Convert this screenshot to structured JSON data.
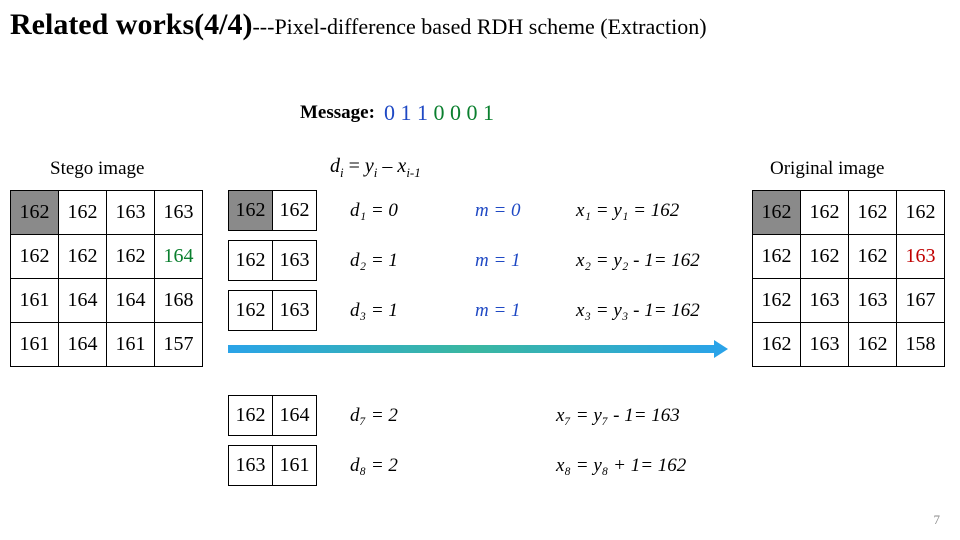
{
  "title_main": "Related works(4/4)",
  "title_sub": "---Pixel-difference based RDH scheme (Extraction)",
  "message_label": "Message:",
  "message_bits": [
    "0",
    "1",
    "1",
    "0",
    "0",
    "0",
    "1"
  ],
  "bit_colors": [
    "blue",
    "blue",
    "blue",
    "green",
    "green",
    "green",
    "green"
  ],
  "formula_d": {
    "lhs": "d",
    "sub": "i",
    "eq": " = ",
    "y": "y",
    "ysub": "i",
    "minus": " – ",
    "x": "x",
    "xsub": "i-1"
  },
  "labels": {
    "stego": "Stego image",
    "orig": "Original image"
  },
  "stego": [
    [
      {
        "v": "162",
        "c": "shade"
      },
      {
        "v": "162"
      },
      {
        "v": "163"
      },
      {
        "v": "163"
      }
    ],
    [
      {
        "v": "162"
      },
      {
        "v": "162"
      },
      {
        "v": "162"
      },
      {
        "v": "164",
        "c": "green"
      }
    ],
    [
      {
        "v": "161"
      },
      {
        "v": "164"
      },
      {
        "v": "164"
      },
      {
        "v": "168"
      }
    ],
    [
      {
        "v": "161"
      },
      {
        "v": "164"
      },
      {
        "v": "161"
      },
      {
        "v": "157"
      }
    ]
  ],
  "orig": [
    [
      {
        "v": "162",
        "c": "shade"
      },
      {
        "v": "162"
      },
      {
        "v": "162"
      },
      {
        "v": "162"
      }
    ],
    [
      {
        "v": "162"
      },
      {
        "v": "162"
      },
      {
        "v": "162"
      },
      {
        "v": "163",
        "c": "red"
      }
    ],
    [
      {
        "v": "162"
      },
      {
        "v": "163"
      },
      {
        "v": "163"
      },
      {
        "v": "167"
      }
    ],
    [
      {
        "v": "162"
      },
      {
        "v": "163"
      },
      {
        "v": "162"
      },
      {
        "v": "158"
      }
    ]
  ],
  "pairs": [
    {
      "a": "162",
      "ac": "shade",
      "b": "162"
    },
    {
      "a": "162",
      "b": "163"
    },
    {
      "a": "162",
      "b": "163"
    },
    {
      "a": "162",
      "b": "164"
    },
    {
      "a": "163",
      "b": "161"
    }
  ],
  "eqs": {
    "d": [
      "d₁ = 0",
      "d₂ = 1",
      "d₃ = 1",
      "d₇ = 2",
      "d₈ = 2"
    ],
    "m": [
      "m = 0",
      "m = 1",
      "m = 1"
    ],
    "x": [
      "x₁ = y₁ = 162",
      "x₂ = y₂ - 1= 162",
      "x₃ = y₃ - 1= 162",
      "x₇ = y₇ - 1= 163",
      "x₈ = y₈ + 1= 162"
    ]
  },
  "page_number": "7"
}
